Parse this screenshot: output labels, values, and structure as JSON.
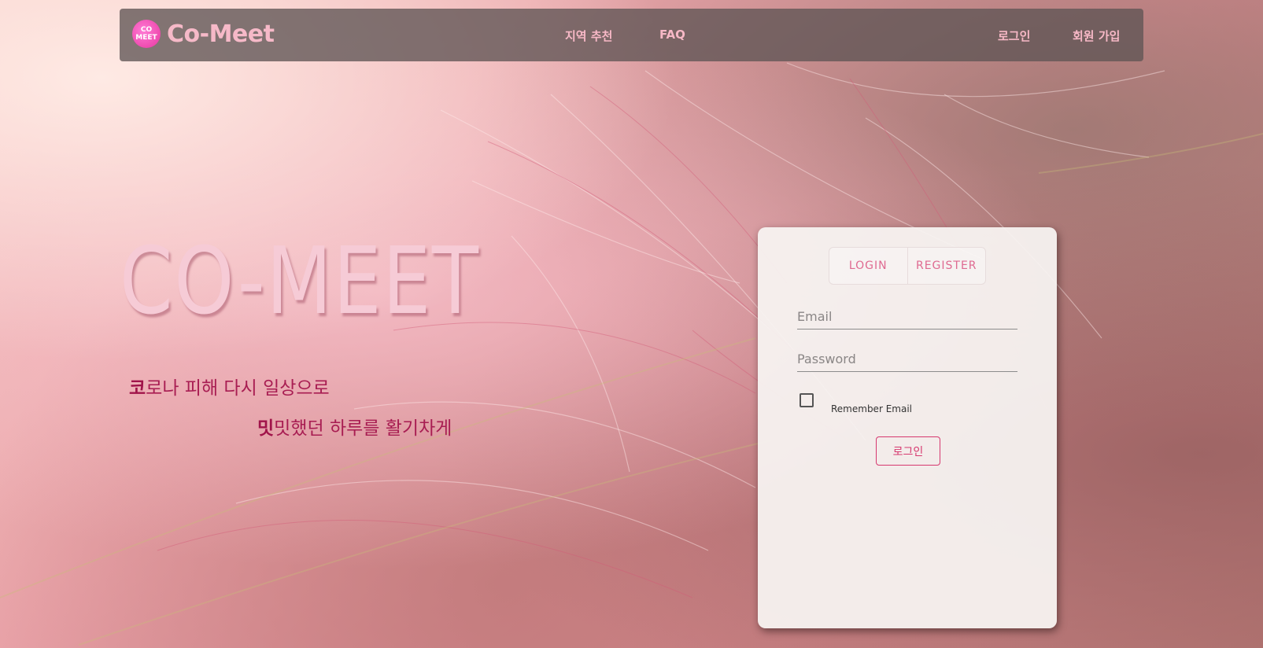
{
  "brand": {
    "logo_top": "CO",
    "logo_bottom": "MEET",
    "name": "Co-Meet"
  },
  "nav": {
    "center": [
      "지역 추천",
      "FAQ"
    ],
    "right": [
      "로그인",
      "회원 가입"
    ]
  },
  "hero": {
    "title": "CO-MEET",
    "line1_bold": "코",
    "line1_rest": "로나 피해 다시 일상으로",
    "line2_bold": "밋",
    "line2_rest": "밋했던 하루를 활기차게"
  },
  "login_card": {
    "tab_login": "LOGIN",
    "tab_register": "REGISTER",
    "email_placeholder": "Email",
    "password_placeholder": "Password",
    "remember_label": "Remember Email",
    "submit_label": "로그인"
  },
  "colors": {
    "brand_pink": "#f6b9c8",
    "accent": "#d6386f",
    "tagline": "#a81d52",
    "navbar_bg": "#5f5555"
  }
}
